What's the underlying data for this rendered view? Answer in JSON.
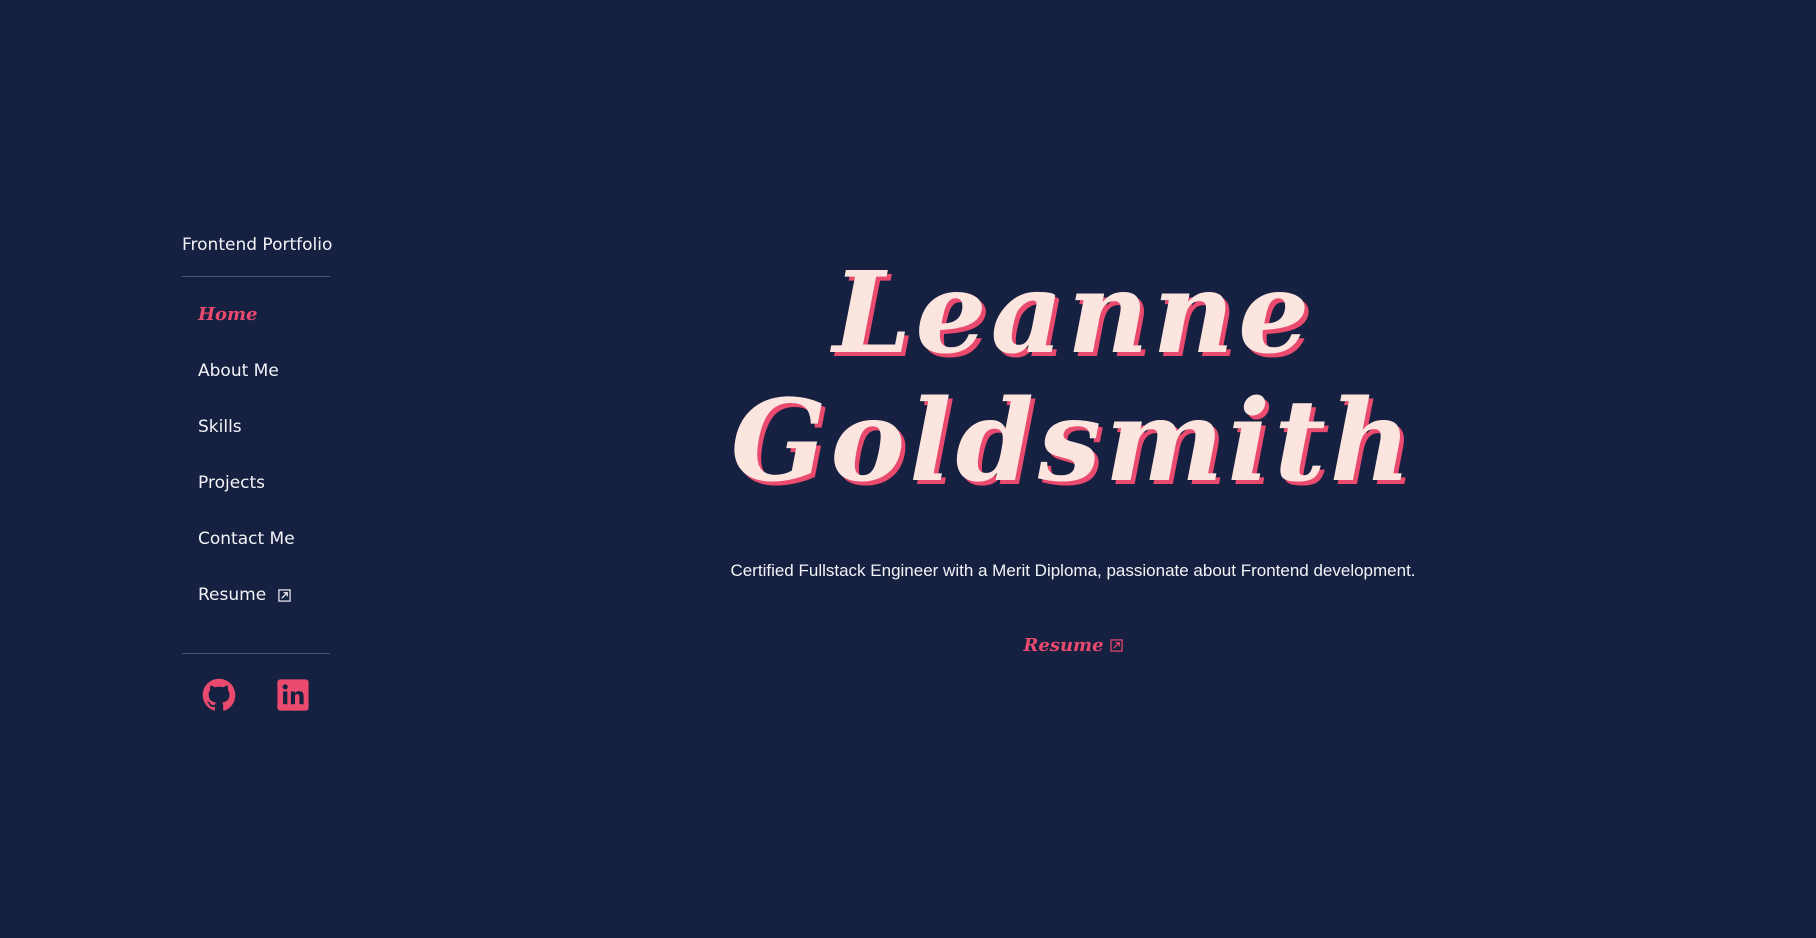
{
  "sidebar": {
    "brand": "Frontend Portfolio",
    "nav": [
      {
        "label": "Home",
        "active": true
      },
      {
        "label": "About Me"
      },
      {
        "label": "Skills"
      },
      {
        "label": "Projects"
      },
      {
        "label": "Contact Me"
      },
      {
        "label": "Resume",
        "icon": "external-link-icon"
      }
    ],
    "socials": [
      {
        "icon": "github-icon"
      },
      {
        "icon": "linkedin-icon"
      }
    ]
  },
  "hero": {
    "name_line1": "Leanne",
    "name_line2": "Goldsmith",
    "tagline": "Certified Fullstack Engineer with a Merit Diploma, passionate about Frontend development.",
    "cta_label": "Resume",
    "cta_icon": "external-link-icon"
  },
  "colors": {
    "background": "#162040",
    "accent": "#e94a6e",
    "name_fill": "#fbe5de",
    "text": "#f3f3f8"
  }
}
